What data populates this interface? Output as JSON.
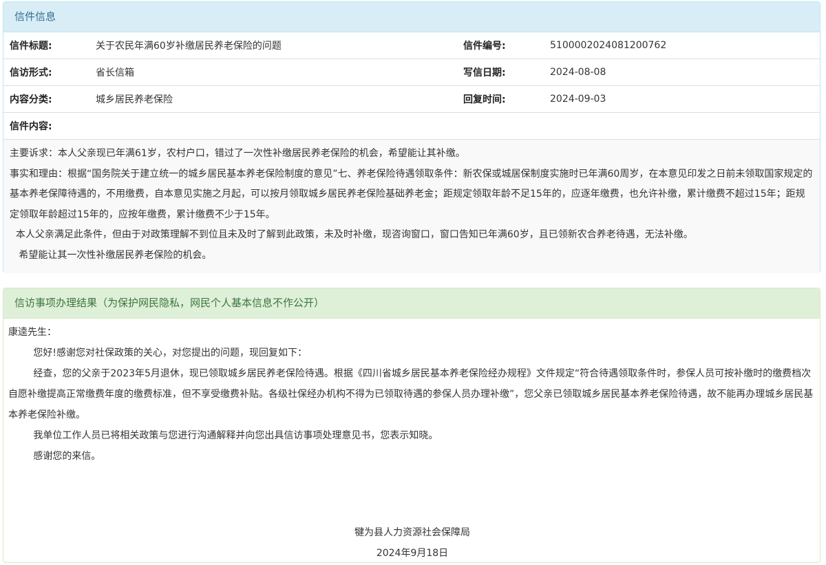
{
  "letter": {
    "header": "信件信息",
    "rows": [
      {
        "l1": "信件标题:",
        "v1": "关于农民年满60岁补缴居民养老保险的问题",
        "l2": "信件编号:",
        "v2": "5100002024081200762"
      },
      {
        "l1": "信访形式:",
        "v1": "省长信箱",
        "l2": "写信日期:",
        "v2": "2024-08-08"
      },
      {
        "l1": "内容分类:",
        "v1": "城乡居民养老保险",
        "l2": "回复时间:",
        "v2": "2024-09-03"
      }
    ],
    "content_label": "信件内容:",
    "paragraphs": [
      "主要诉求：本人父亲现已年满61岁，农村户口，错过了一次性补缴居民养老保险的机会，希望能让其补缴。",
      "事实和理由：根据“国务院关于建立统一的城乡居民基本养老保险制度的意见”七、养老保险待遇领取条件：新农保或城居保制度实施时已年满60周岁，在本意见印发之日前未领取国家规定的基本养老保障待遇的，不用缴费，自本意见实施之月起，可以按月领取城乡居民养老保险基础养老金；距规定领取年龄不足15年的，应逐年缴费，也允许补缴，累计缴费不超过15年；距规定领取年龄超过15年的，应按年缴费，累计缴费不少于15年。",
      "  本人父亲满足此条件，但由于对政策理解不到位且未及时了解到此政策，未及时补缴，现咨询窗口，窗口告知已年满60岁，且已领新农合养老待遇，无法补缴。",
      "   希望能让其一次性补缴居民养老保险的机会。"
    ]
  },
  "result": {
    "header": "信访事项办理结果（为保护网民隐私，网民个人基本信息不作公开）",
    "greeting": "康逵先生：",
    "paragraphs": [
      "您好!感谢您对社保政策的关心，对您提出的问题，现回复如下：",
      "经查，您的父亲于2023年5月退休，现已领取城乡居民养老保险待遇。根据《四川省城乡居民基本养老保险经办规程》文件规定“符合待遇领取条件时，参保人员可按补缴时的缴费档次自愿补缴提高正常缴费年度的缴费标准，但不享受缴费补贴。各级社保经办机构不得为已领取待遇的参保人员办理补缴”，您父亲已领取城乡居民基本养老保险待遇，故不能再办理城乡居民基本养老保险补缴。",
      "我单位工作人员已将相关政策与您进行沟通解释并向您出具信访事项处理意见书，您表示知晓。",
      "感谢您的来信。"
    ],
    "signature": "犍为县人力资源社会保障局",
    "date": "2024年9月18日"
  }
}
